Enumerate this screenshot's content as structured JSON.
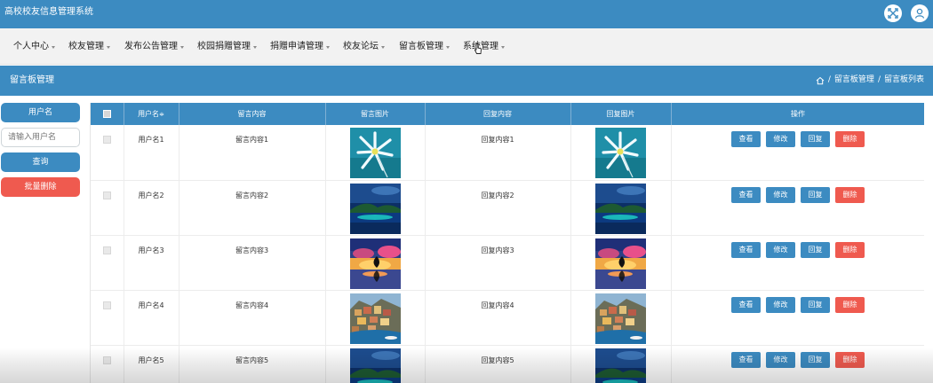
{
  "app": {
    "title": "高校校友信息管理系统"
  },
  "topbar": {
    "icons": [
      "fullscreen-icon",
      "user-icon"
    ]
  },
  "menu": {
    "items": [
      {
        "label": "个人中心"
      },
      {
        "label": "校友管理"
      },
      {
        "label": "发布公告管理"
      },
      {
        "label": "校园捐赠管理"
      },
      {
        "label": "捐赠申请管理"
      },
      {
        "label": "校友论坛"
      },
      {
        "label": "留言板管理"
      },
      {
        "label": "系统管理"
      }
    ]
  },
  "section": {
    "title": "留言板管理",
    "breadcrumb": {
      "items": [
        "留言板管理",
        "留言板列表"
      ],
      "separator": "/",
      "icon": "home-icon"
    }
  },
  "sidebar": {
    "label": "用户名",
    "input_placeholder": "请输入用户名",
    "search_label": "查询",
    "batch_delete_label": "批量删除"
  },
  "table": {
    "headers": {
      "username": "用户名",
      "sort_icon": "≑",
      "message": "留言内容",
      "message_image": "留言图片",
      "reply": "回复内容",
      "reply_image": "回复图片",
      "actions": "操作"
    },
    "action_labels": {
      "view": "查看",
      "edit": "修改",
      "reply": "回复",
      "delete": "删除"
    },
    "rows": [
      {
        "username": "用户名1",
        "message": "留言内容1",
        "image": "flower",
        "reply": "回复内容1",
        "reply_image": "flower"
      },
      {
        "username": "用户名2",
        "message": "留言内容2",
        "image": "island",
        "reply": "回复内容2",
        "reply_image": "island"
      },
      {
        "username": "用户名3",
        "message": "留言内容3",
        "image": "sunset",
        "reply": "回复内容3",
        "reply_image": "sunset"
      },
      {
        "username": "用户名4",
        "message": "留言内容4",
        "image": "cliff-town",
        "reply": "回复内容4",
        "reply_image": "cliff-town"
      },
      {
        "username": "用户名5",
        "message": "留言内容5",
        "image": "island",
        "reply": "回复内容5",
        "reply_image": "island"
      }
    ]
  },
  "colors": {
    "primary": "#3c8bc1",
    "danger": "#ef5a4f",
    "menu_bg": "#f2f2f2"
  }
}
